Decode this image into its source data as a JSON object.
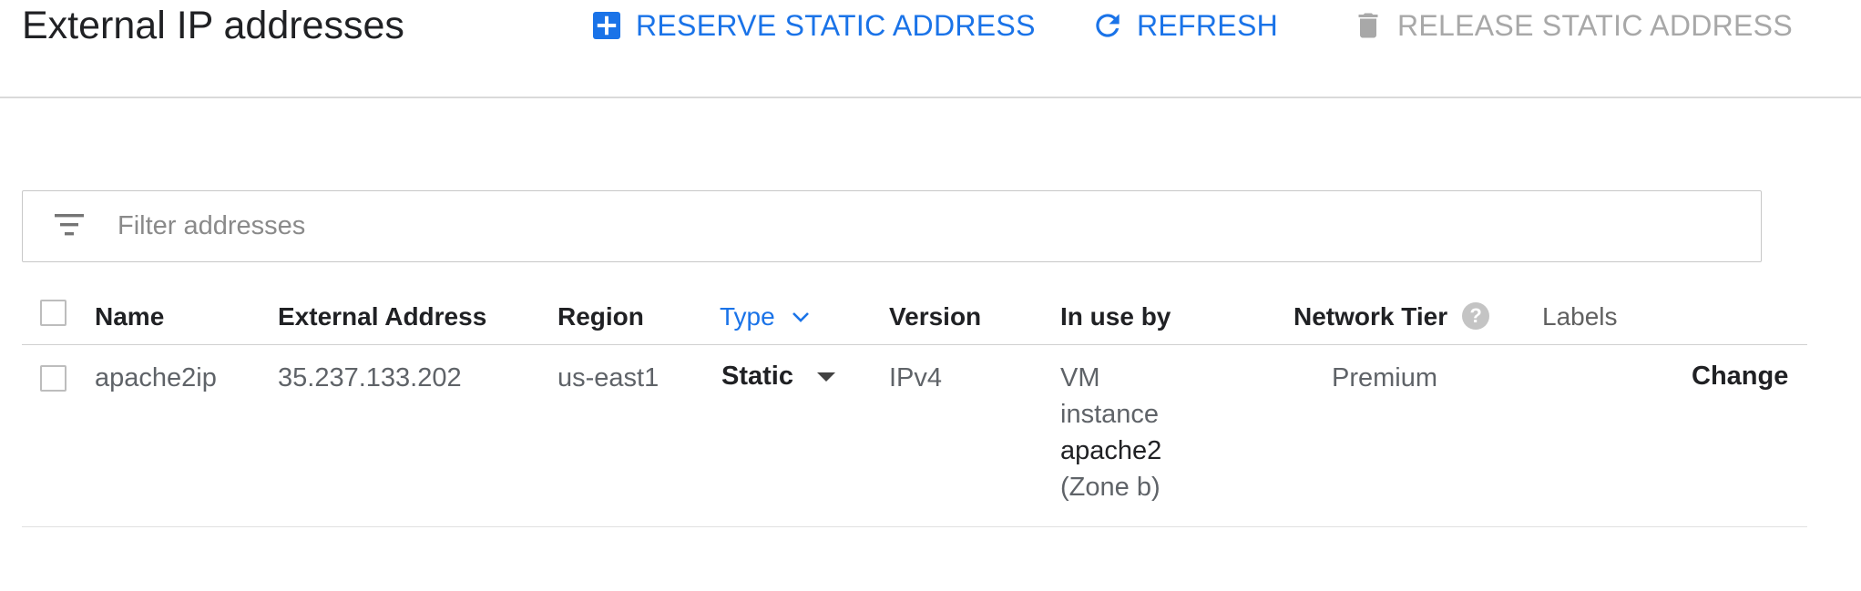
{
  "header": {
    "title": "External IP addresses",
    "actions": {
      "reserve": "RESERVE STATIC ADDRESS",
      "refresh": "REFRESH",
      "release": "RELEASE STATIC ADDRESS"
    }
  },
  "filter": {
    "placeholder": "Filter addresses",
    "value": ""
  },
  "table": {
    "columns": {
      "name": "Name",
      "external_address": "External Address",
      "region": "Region",
      "type": "Type",
      "version": "Version",
      "in_use_by": "In use by",
      "network_tier": "Network Tier",
      "labels": "Labels"
    },
    "sorted_column": "Type",
    "rows": [
      {
        "name": "apache2ip",
        "external_address": "35.237.133.202",
        "region": "us-east1",
        "type": "Static",
        "version": "IPv4",
        "in_use_by": {
          "line1": "VM",
          "line2": "instance",
          "instance": "apache2",
          "zone": "(Zone b)"
        },
        "network_tier": "Premium",
        "change_label": "Change"
      }
    ]
  },
  "colors": {
    "accent": "#1a73e8",
    "disabled": "#a8a8a8",
    "text_primary": "#202124",
    "text_secondary": "#5f6368"
  },
  "icons": {
    "reserve": "add-box-icon",
    "refresh": "refresh-icon",
    "release": "trash-icon",
    "filter": "filter-list-icon",
    "sort": "chevron-down-icon",
    "help": "help-icon",
    "dropdown": "caret-down-icon"
  }
}
